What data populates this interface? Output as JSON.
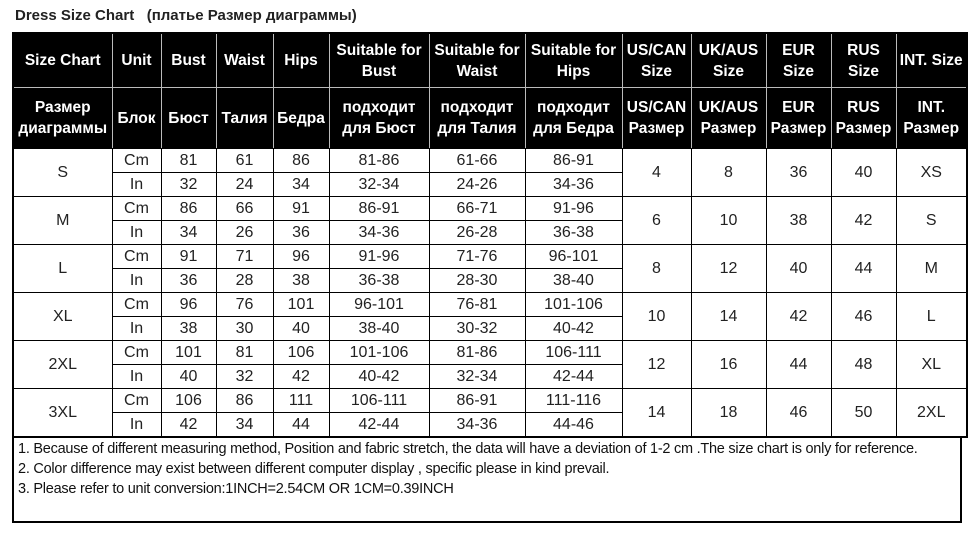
{
  "title": "Dress Size Chart   (платье Размер диаграммы)",
  "header_en": [
    "Size Chart",
    "Unit",
    "Bust",
    "Waist",
    "Hips",
    "Suitable for Bust",
    "Suitable for Waist",
    "Suitable for Hips",
    "US/CAN Size",
    "UK/AUS Size",
    "EUR Size",
    "RUS Size",
    "INT. Size"
  ],
  "header_ru": [
    "Размер диаграммы",
    "Блок",
    "Бюст",
    "Талия",
    "Бедра",
    "подходит для Бюст",
    "подходит для Талия",
    "подходит для Бедра",
    "US/CAN Размер",
    "UK/AUS Размер",
    "EUR Размер",
    "RUS Размер",
    "INT. Размер"
  ],
  "units": [
    "Cm",
    "In"
  ],
  "sizes": [
    {
      "size": "S",
      "cm": [
        "81",
        "61",
        "86",
        "81-86",
        "61-66",
        "86-91"
      ],
      "in": [
        "32",
        "24",
        "34",
        "32-34",
        "24-26",
        "34-36"
      ],
      "us_can": "4",
      "uk_aus": "8",
      "eur": "36",
      "rus": "40",
      "int": "XS"
    },
    {
      "size": "M",
      "cm": [
        "86",
        "66",
        "91",
        "86-91",
        "66-71",
        "91-96"
      ],
      "in": [
        "34",
        "26",
        "36",
        "34-36",
        "26-28",
        "36-38"
      ],
      "us_can": "6",
      "uk_aus": "10",
      "eur": "38",
      "rus": "42",
      "int": "S"
    },
    {
      "size": "L",
      "cm": [
        "91",
        "71",
        "96",
        "91-96",
        "71-76",
        "96-101"
      ],
      "in": [
        "36",
        "28",
        "38",
        "36-38",
        "28-30",
        "38-40"
      ],
      "us_can": "8",
      "uk_aus": "12",
      "eur": "40",
      "rus": "44",
      "int": "M"
    },
    {
      "size": "XL",
      "cm": [
        "96",
        "76",
        "101",
        "96-101",
        "76-81",
        "101-106"
      ],
      "in": [
        "38",
        "30",
        "40",
        "38-40",
        "30-32",
        "40-42"
      ],
      "us_can": "10",
      "uk_aus": "14",
      "eur": "42",
      "rus": "46",
      "int": "L"
    },
    {
      "size": "2XL",
      "cm": [
        "101",
        "81",
        "106",
        "101-106",
        "81-86",
        "106-111"
      ],
      "in": [
        "40",
        "32",
        "42",
        "40-42",
        "32-34",
        "42-44"
      ],
      "us_can": "12",
      "uk_aus": "16",
      "eur": "44",
      "rus": "48",
      "int": "XL"
    },
    {
      "size": "3XL",
      "cm": [
        "106",
        "86",
        "111",
        "106-111",
        "86-91",
        "111-116"
      ],
      "in": [
        "42",
        "34",
        "44",
        "42-44",
        "34-36",
        "44-46"
      ],
      "us_can": "14",
      "uk_aus": "18",
      "eur": "46",
      "rus": "50",
      "int": "2XL"
    }
  ],
  "notes": [
    "1. Because of different measuring method, Position and fabric stretch, the data will have a deviation of 1-2 cm .The size chart is only for reference.",
    "2. Color difference may exist between different computer display , specific please in kind prevail.",
    "3. Please refer to unit conversion:1INCH=2.54CM OR 1CM=0.39INCH"
  ]
}
